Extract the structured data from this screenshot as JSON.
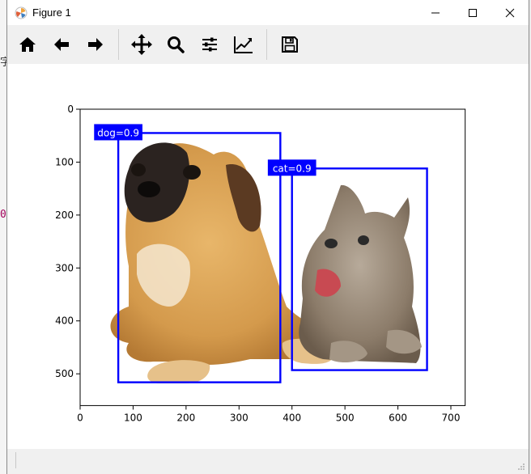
{
  "window": {
    "title": "Figure 1"
  },
  "toolbar": {
    "buttons": [
      {
        "name": "home-icon",
        "tooltip": "Reset original view"
      },
      {
        "name": "back-arrow-icon",
        "tooltip": "Back"
      },
      {
        "name": "forward-arrow-icon",
        "tooltip": "Forward"
      },
      {
        "name": "pan-icon",
        "tooltip": "Pan"
      },
      {
        "name": "zoom-icon",
        "tooltip": "Zoom"
      },
      {
        "name": "configure-subplots-icon",
        "tooltip": "Configure subplots"
      },
      {
        "name": "edit-axis-icon",
        "tooltip": "Edit axis"
      },
      {
        "name": "save-icon",
        "tooltip": "Save the figure"
      }
    ]
  },
  "figure": {
    "x_ticks": [
      "0",
      "100",
      "200",
      "300",
      "400",
      "500",
      "600",
      "700"
    ],
    "y_ticks": [
      "0",
      "100",
      "200",
      "300",
      "400",
      "500"
    ],
    "boxes": [
      {
        "label": "dog=0.9",
        "x1": 72,
        "y1": 45,
        "x2": 378,
        "y2": 516,
        "color": "#0000ff"
      },
      {
        "label": "cat=0.9",
        "x1": 400,
        "y1": 112,
        "x2": 655,
        "y2": 493,
        "color": "#0000ff"
      }
    ]
  },
  "left_edge": {
    "glyph_top": "字",
    "glyph_mid": "0"
  }
}
